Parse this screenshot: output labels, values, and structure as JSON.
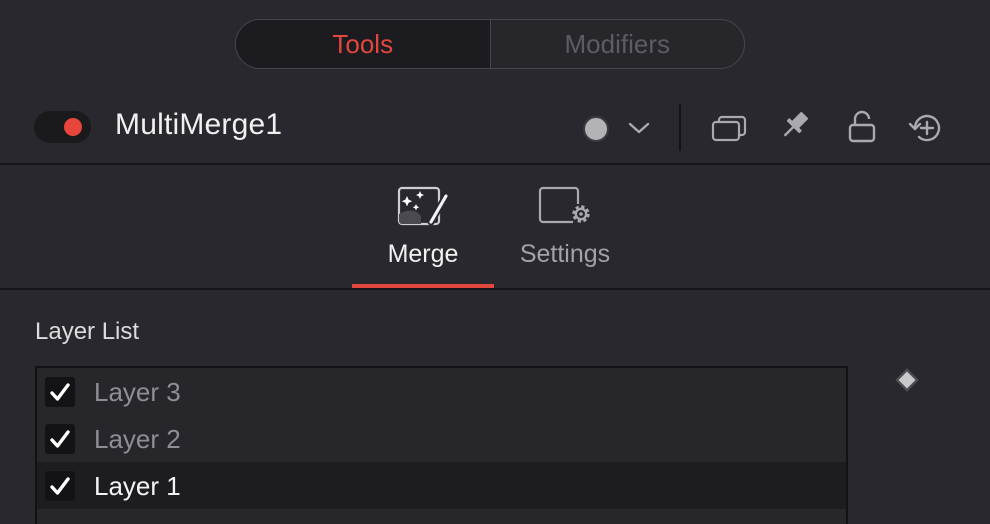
{
  "top_tabs": [
    {
      "label": "Tools",
      "active": true
    },
    {
      "label": "Modifiers",
      "active": false
    }
  ],
  "header": {
    "node_name": "MultiMerge1",
    "enabled": true,
    "colors": {
      "toggle_dot": "#e8463d",
      "accent": "#e2473e",
      "color_dot": "#b3b3b6"
    },
    "icons": [
      "color-swatch-icon",
      "chevron-down-icon",
      "versions-icon",
      "pin-icon",
      "lock-icon",
      "reset-icon"
    ]
  },
  "sub_tabs": [
    {
      "label": "Merge",
      "icon": "merge-wand-icon",
      "active": true
    },
    {
      "label": "Settings",
      "icon": "settings-gear-icon",
      "active": false
    }
  ],
  "layer_list": {
    "label": "Layer List",
    "items": [
      {
        "label": "Layer 3",
        "checked": true,
        "selected": false
      },
      {
        "label": "Layer 2",
        "checked": true,
        "selected": false
      },
      {
        "label": "Layer 1",
        "checked": true,
        "selected": true
      }
    ]
  },
  "keyframe_icon": "keyframe-diamond-icon"
}
